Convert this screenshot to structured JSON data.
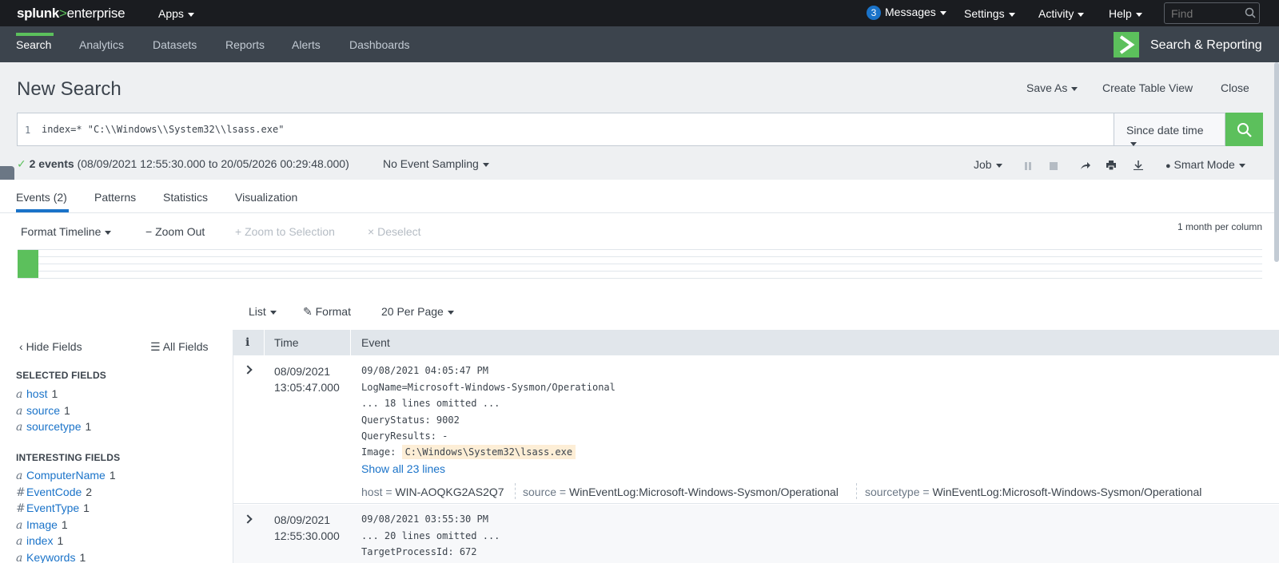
{
  "topbar": {
    "logo_main": "splunk",
    "logo_sep": ">",
    "logo_sub": "enterprise",
    "apps": "Apps",
    "messages_count": "3",
    "messages": "Messages",
    "settings": "Settings",
    "activity": "Activity",
    "help": "Help",
    "find_placeholder": "Find"
  },
  "appbar": {
    "tabs": [
      "Search",
      "Analytics",
      "Datasets",
      "Reports",
      "Alerts",
      "Dashboards"
    ],
    "app_title": "Search & Reporting"
  },
  "search": {
    "title": "New Search",
    "save_as": "Save As",
    "create_table_view": "Create Table View",
    "close": "Close",
    "line_number": "1",
    "query": "index=* \"C:\\\\Windows\\\\System32\\\\lsass.exe\"",
    "time_range": "Since date time",
    "event_count": "2 events",
    "event_range": "(08/09/2021 12:55:30.000 to 20/05/2026 00:29:48.000)",
    "sampling": "No Event Sampling",
    "job": "Job",
    "mode": "Smart Mode"
  },
  "tabs": [
    "Events (2)",
    "Patterns",
    "Statistics",
    "Visualization"
  ],
  "timeline": {
    "format": "Format Timeline",
    "zoom_out": "Zoom Out",
    "zoom_selection": "Zoom to Selection",
    "deselect": "Deselect",
    "scale": "1 month per column"
  },
  "list_controls": {
    "list": "List",
    "format": "Format",
    "per_page": "20 Per Page"
  },
  "fields": {
    "hide": "Hide Fields",
    "all": "All Fields",
    "selected_title": "SELECTED FIELDS",
    "selected": [
      {
        "type": "a",
        "name": "host",
        "count": "1"
      },
      {
        "type": "a",
        "name": "source",
        "count": "1"
      },
      {
        "type": "a",
        "name": "sourcetype",
        "count": "1"
      }
    ],
    "interesting_title": "INTERESTING FIELDS",
    "interesting": [
      {
        "type": "a",
        "name": "ComputerName",
        "count": "1"
      },
      {
        "type": "#",
        "name": "EventCode",
        "count": "2"
      },
      {
        "type": "#",
        "name": "EventType",
        "count": "1"
      },
      {
        "type": "a",
        "name": "Image",
        "count": "1"
      },
      {
        "type": "a",
        "name": "index",
        "count": "1"
      },
      {
        "type": "a",
        "name": "Keywords",
        "count": "1"
      }
    ]
  },
  "events": {
    "col_info": "i",
    "col_time": "Time",
    "col_event": "Event",
    "rows": [
      {
        "date": "08/09/2021",
        "time": "13:05:47.000",
        "lines": [
          "09/08/2021 04:05:47 PM",
          "LogName=Microsoft-Windows-Sysmon/Operational",
          "... 18 lines omitted ...",
          "QueryStatus: 9002",
          "QueryResults: -"
        ],
        "image_label": "Image: ",
        "image_value": "C:\\Windows\\System32\\lsass.exe",
        "show_all": "Show all 23 lines",
        "host_label": "host = ",
        "host": "WIN-AOQKG2AS2Q7",
        "source_label": "source = ",
        "source": "WinEventLog:Microsoft-Windows-Sysmon/Operational",
        "sourcetype_label": "sourcetype = ",
        "sourcetype": "WinEventLog:Microsoft-Windows-Sysmon/Operational"
      },
      {
        "date": "08/09/2021",
        "time": "12:55:30.000",
        "lines": [
          "09/08/2021 03:55:30 PM",
          "... 20 lines omitted ...",
          "TargetProcessId: 672"
        ]
      }
    ]
  },
  "colors": {
    "brand_green": "#5cc05c",
    "link_blue": "#1a73c9",
    "header_dark": "#1a1c20",
    "appbar": "#3c444d"
  }
}
